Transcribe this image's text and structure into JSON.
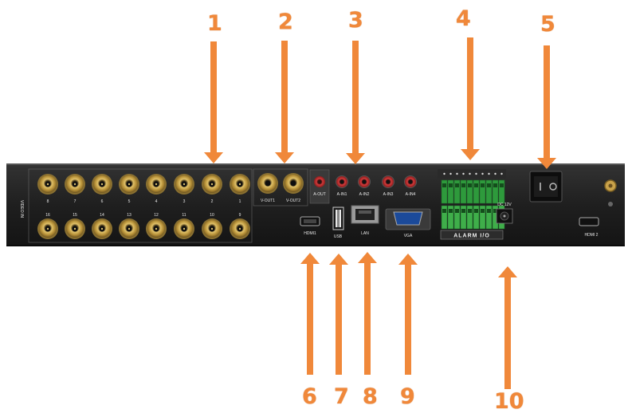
{
  "callouts": {
    "c1": "1",
    "c2": "2",
    "c3": "3",
    "c4": "4",
    "c5": "5",
    "c6": "6",
    "c7": "7",
    "c8": "8",
    "c9": "9",
    "c10": "10"
  },
  "panel": {
    "video_in_label": "VIDEO IN",
    "bnc_top_numbers": [
      "8",
      "7",
      "6",
      "5",
      "4",
      "3",
      "2",
      "1"
    ],
    "bnc_bottom_numbers": [
      "16",
      "15",
      "14",
      "13",
      "12",
      "11",
      "10",
      "9"
    ],
    "vout_labels": [
      "V-OUT1",
      "V-OUT2"
    ],
    "aout_label": "A-OUT",
    "ain_labels": [
      "A-IN1",
      "A-IN2",
      "A-IN3",
      "A-IN4"
    ],
    "hdmi1_label": "HDMI1",
    "usb_label": "USB",
    "lan_label": "LAN",
    "vga_label": "VGA",
    "alarm_label": "ALARM I/O",
    "dc_label": "DC 12V",
    "hdmi2_label": "HDMI 2"
  },
  "colors": {
    "arrow": "#f0883a",
    "panel": "#252525",
    "gold": "#c9a24a",
    "terminal": "#3fae4a"
  }
}
